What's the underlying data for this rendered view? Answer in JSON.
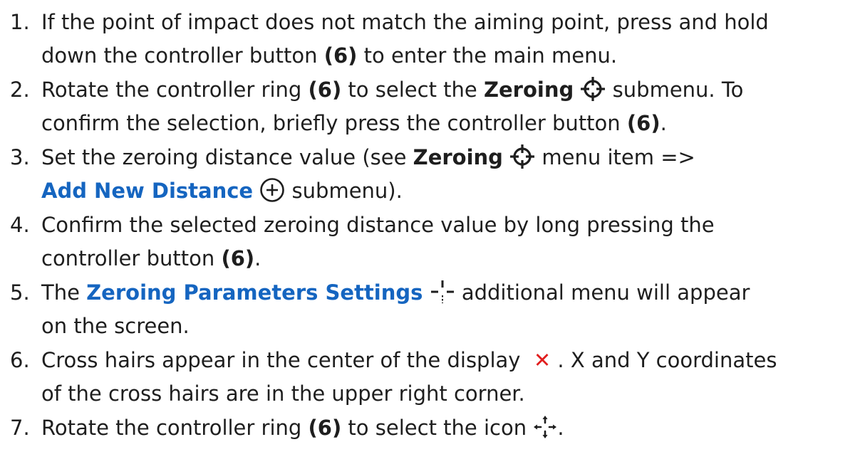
{
  "steps": [
    {
      "num": "1.",
      "line1": {
        "a": "If the point of impact does not match the aiming point, press and hold"
      },
      "line2": {
        "a": "down the controller button ",
        "b": "(6)",
        "c": " to enter the main menu."
      }
    },
    {
      "num": "2.",
      "line1": {
        "a": "Rotate the controller ring ",
        "b": "(6)",
        "c": " to select the ",
        "d": "Zeroing",
        "e": " submenu. To"
      },
      "line2": {
        "a": "confirm the selection, briefly press the controller button ",
        "b": "(6)",
        "c": "."
      }
    },
    {
      "num": "3.",
      "line1": {
        "a": "Set the zeroing distance value (see ",
        "b": "Zeroing",
        "c": " menu item =>"
      },
      "line2": {
        "a": "Add New Distance",
        "b": " submenu)."
      }
    },
    {
      "num": "4.",
      "line1": {
        "a": "Confirm the selected zeroing distance value by long pressing the"
      },
      "line2": {
        "a": "controller button ",
        "b": "(6)",
        "c": "."
      }
    },
    {
      "num": "5.",
      "line1": {
        "a": "The ",
        "b": "Zeroing Parameters Settings",
        "c": " additional menu will appear"
      },
      "line2": {
        "a": "on the screen."
      }
    },
    {
      "num": "6.",
      "line1": {
        "a": "Cross hairs appear in the center of the display ",
        "b": "✕",
        "c": ". X and Y coordinates"
      },
      "line2": {
        "a": "of the cross hairs are in the upper right corner."
      }
    },
    {
      "num": "7.",
      "line1": {
        "a": "Rotate the controller ring ",
        "b": "(6)",
        "c": " to select the icon ",
        "d": "."
      }
    }
  ],
  "icons": {
    "zeroing": "crosshair-target-icon",
    "add_distance": "plus-circle-icon",
    "params": "crosshair-lines-icon",
    "move": "four-arrows-icon"
  },
  "colors": {
    "text": "#1e1e1e",
    "link": "#1565c0",
    "cross": "#e11d1d"
  }
}
